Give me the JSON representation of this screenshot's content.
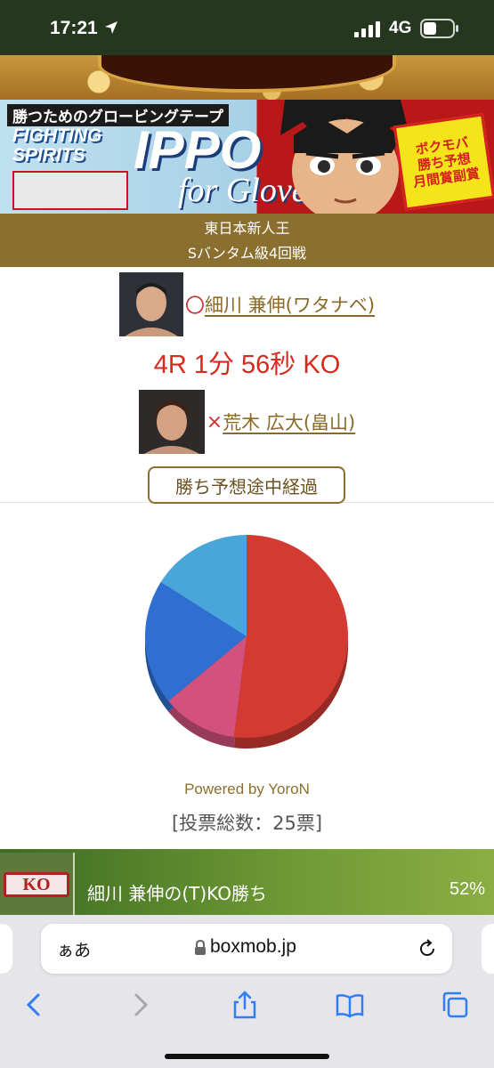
{
  "status_bar": {
    "time": "17:21",
    "network": "4G"
  },
  "banner": {
    "tagline": "勝つためのグロービングテープ",
    "fighting_line1": "FIGHTING",
    "fighting_line2": "SPIRITS",
    "ippo": "IPPO",
    "glove": "for Glove",
    "badge_line1": "ボクモバ",
    "badge_line2": "勝ち予想",
    "badge_line3": "月間賞副賞"
  },
  "event": {
    "line1": "東日本新人王",
    "line2": "Sバンタム級4回戦"
  },
  "winner": {
    "mark": "〇",
    "name": "細川 兼伸(ワタナベ)"
  },
  "result": "4R 1分 56秒 KO",
  "loser": {
    "mark": "×",
    "name": "荒木 広大(畠山)"
  },
  "prediction_button": "勝ち予想途中経過",
  "chart_data": {
    "type": "pie",
    "title": "",
    "values": [
      52,
      12,
      20,
      16
    ],
    "colors": [
      "#d23a32",
      "#d3517d",
      "#2f6fd1",
      "#4aa5da"
    ],
    "powered_by": "Powered by YoroN",
    "vote_total": "[投票総数：25票]"
  },
  "ad": {
    "logo_text": "KO",
    "text": "細川 兼伸の(T)KO勝ち",
    "percent": "52%"
  },
  "browser": {
    "aa_label": "ぁあ",
    "url": "boxmob.jp"
  },
  "icons": [
    "location-arrow-icon",
    "signal-icon",
    "battery-icon",
    "lock-icon",
    "reload-icon",
    "back-icon",
    "forward-icon",
    "share-icon",
    "bookmarks-icon",
    "tabs-icon"
  ]
}
